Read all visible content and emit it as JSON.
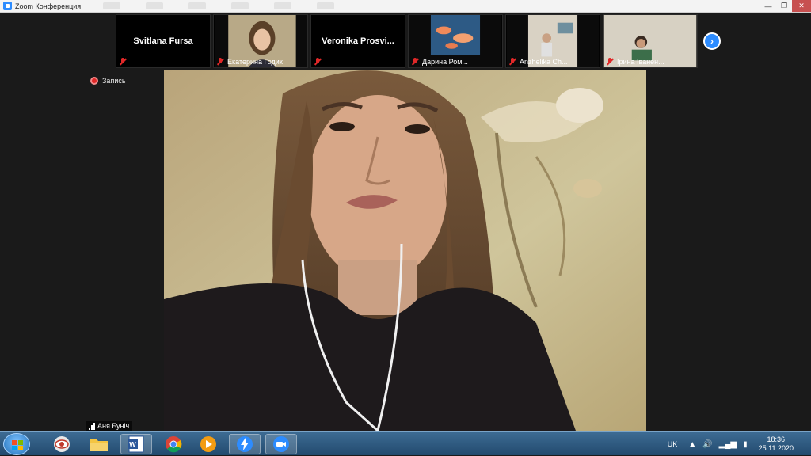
{
  "window": {
    "title": "Zoom Конференция"
  },
  "participants": [
    {
      "big_name": "Svitlana Fursa",
      "name": "",
      "video": false
    },
    {
      "big_name": "",
      "name": "Екатерина Годик",
      "video": true
    },
    {
      "big_name": "Veronika  Prosvi...",
      "name": "",
      "video": false
    },
    {
      "big_name": "",
      "name": "Дарина Ром...",
      "video": true
    },
    {
      "big_name": "",
      "name": "Anzhelika Ch...",
      "video": true
    },
    {
      "big_name": "",
      "name": "Ірина Іванен...",
      "video": true
    }
  ],
  "recording": {
    "label": "Запись",
    "color": "#e02828"
  },
  "active_speaker": {
    "name": "Аня Бунiч"
  },
  "taskbar": {
    "apps": [
      "windows-start",
      "security-app",
      "file-explorer",
      "word",
      "chrome",
      "media-player",
      "zoom-bolt",
      "zoom"
    ],
    "language": "UK",
    "time": "18:36",
    "date": "25.11.2020"
  },
  "colors": {
    "accent": "#2d8cff",
    "muted": "#e02828",
    "background": "#1a1a1a"
  }
}
